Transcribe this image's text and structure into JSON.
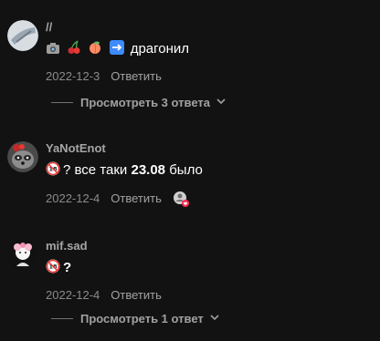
{
  "comments": [
    {
      "username": "//",
      "text_parts": {
        "main": "драгонил"
      },
      "emoji_names": [
        "camera-icon",
        "cherries-icon",
        "peach-icon",
        "right-arrow-icon"
      ],
      "date": "2022-12-3",
      "reply_label": "Ответить",
      "view_replies_label": "Просмотреть 3 ответа"
    },
    {
      "username": "YaNotEnot",
      "text_parts": {
        "pre": "? все таки ",
        "bold": "23.08",
        "post": " было"
      },
      "emoji_names": [
        "no-under-18-icon"
      ],
      "date": "2022-12-4",
      "reply_label": "Ответить"
    },
    {
      "username": "mif.sad",
      "text_parts": {
        "main": "?"
      },
      "emoji_names": [
        "no-under-18-icon"
      ],
      "date": "2022-12-4",
      "reply_label": "Ответить",
      "view_replies_label": "Просмотреть 1 ответ"
    }
  ],
  "colors": {
    "background": "#121212",
    "like_badge": "#fe2c55"
  }
}
